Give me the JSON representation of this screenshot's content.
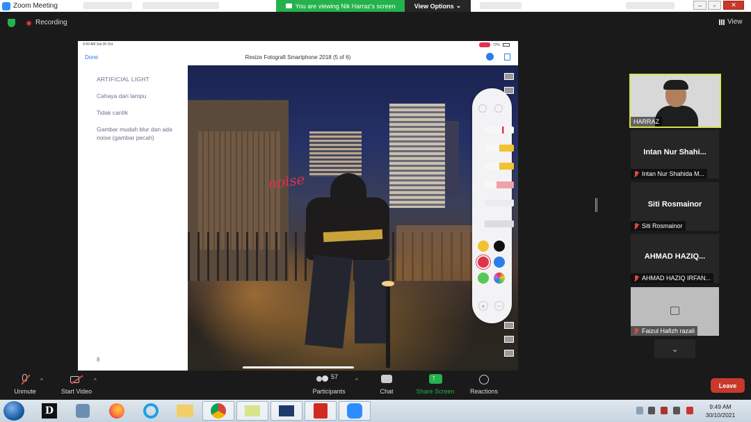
{
  "window": {
    "title": "Zoom Meeting"
  },
  "banner": {
    "viewing": "You are viewing Nik Harraz's screen",
    "view_options": "View Options"
  },
  "status": {
    "recording": "Recording",
    "view": "View"
  },
  "ipad": {
    "time": "9:49 AM  Sat 30 Oct",
    "battery": "72%",
    "done": "Done",
    "doc_title": "Resize Fotografi Smartphone 2018 (5 of 6)",
    "notes": [
      "ARTIFICIAL LIGHT",
      "Cahaya dari lampu",
      "Tidak cantik",
      "Gambar mudah blur dan ada noise (gambar pecah)"
    ],
    "page": "8",
    "annotation": "noise",
    "colors": [
      "#f2c230",
      "#111111",
      "#e0334a",
      "#2b7de9",
      "#56c858",
      "#b070e0"
    ]
  },
  "participants": [
    {
      "name": "HARRAZ",
      "speaking": true
    },
    {
      "name": "Intan Nur Shahi...",
      "label": "Intan Nur Shahida M..."
    },
    {
      "name": "Siti Rosmainor",
      "label": "Siti Rosmainor"
    },
    {
      "name": "AHMAD HAZIQ...",
      "label": "AHMAD HAZIQ IRFAN..."
    },
    {
      "name": "",
      "label": "Faizul Hafizh razali"
    }
  ],
  "toolbar": {
    "unmute": "Unmute",
    "start_video": "Start Video",
    "participants": "Participants",
    "participants_count": "57",
    "chat": "Chat",
    "share_screen": "Share Screen",
    "reactions": "Reactions",
    "leave": "Leave"
  },
  "taskbar": {
    "time": "9:49 AM",
    "date": "30/10/2021"
  }
}
